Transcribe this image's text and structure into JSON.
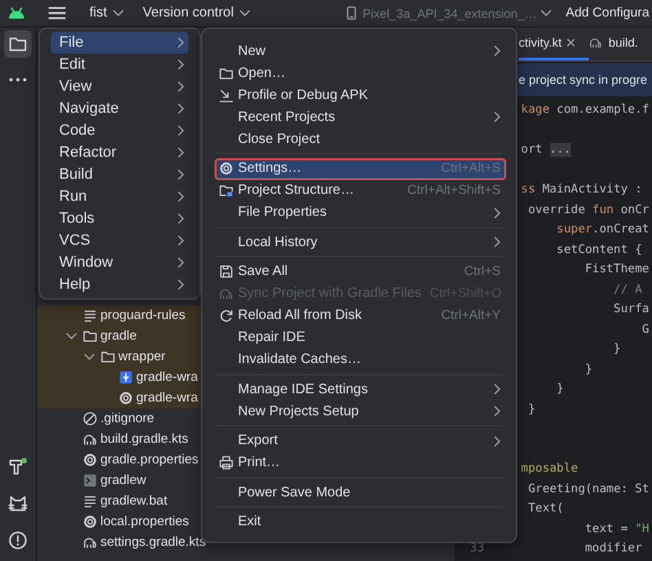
{
  "top_bar": {
    "project": "fist",
    "vcs": "Version control",
    "device": {
      "label": "Pixel_3a_API_34_extension_…",
      "disabled": true
    },
    "run_config": "Add Configura"
  },
  "tool_strip": {
    "top": [
      {
        "kind": "folder",
        "selected": true
      },
      {
        "kind": "more",
        "selected": false
      }
    ],
    "bottom": [
      {
        "kind": "hammer",
        "selected": false
      },
      {
        "kind": "cat",
        "selected": false
      },
      {
        "kind": "problems",
        "selected": false
      }
    ]
  },
  "project_tree": [
    {
      "name": "proguard-rules",
      "kind": "text",
      "shaded": true
    },
    {
      "name": "gradle",
      "kind": "folder",
      "expanded": true,
      "shaded": true,
      "children": [
        {
          "name": "wrapper",
          "kind": "folder",
          "expanded": true,
          "shaded": true,
          "children": [
            {
              "name": "gradle-wra",
              "kind": "archive",
              "shaded": true
            },
            {
              "name": "gradle-wra",
              "kind": "settings",
              "shaded": true
            }
          ]
        }
      ]
    },
    {
      "name": ".gitignore",
      "kind": "ignore",
      "shaded": false
    },
    {
      "name": "build.gradle.kts",
      "kind": "script",
      "shaded": false
    },
    {
      "name": "gradle.properties",
      "kind": "settings",
      "shaded": false
    },
    {
      "name": "gradlew",
      "kind": "terminal",
      "shaded": false
    },
    {
      "name": "gradlew.bat",
      "kind": "text",
      "shaded": false
    },
    {
      "name": "local.properties",
      "kind": "settings",
      "shaded": false
    },
    {
      "name": "settings.gradle.kts",
      "kind": "script",
      "shaded": false
    }
  ],
  "editor": {
    "tabs": [
      {
        "label": "ctivity.kt",
        "kind": "plain",
        "selected": true,
        "closable": true
      },
      {
        "label": "build.",
        "kind": "script",
        "selected": false,
        "closable": false
      }
    ],
    "notice": "e project sync in progre",
    "lines": [
      {
        "kind": "code",
        "tokens": [
          {
            "text": "kage",
            "kind": "keyword"
          },
          {
            "text": " com.example.f",
            "kind": "plain"
          }
        ]
      },
      {
        "kind": "blank"
      },
      {
        "kind": "code",
        "tokens": [
          {
            "text": "ort ",
            "kind": "plain"
          },
          {
            "text": "...",
            "kind": "fold"
          }
        ]
      },
      {
        "kind": "blank"
      },
      {
        "kind": "code",
        "tokens": [
          {
            "text": "ss",
            "kind": "keyword"
          },
          {
            "text": " MainActivity :",
            "kind": "plain"
          }
        ]
      },
      {
        "kind": "code",
        "tokens": [
          {
            "text": " override ",
            "kind": "plain"
          },
          {
            "text": "fun",
            "kind": "keyword"
          },
          {
            "text": " onCr",
            "kind": "plain"
          }
        ]
      },
      {
        "kind": "code",
        "tokens": [
          {
            "text": "     super",
            "kind": "keyword"
          },
          {
            "text": ".onCreat",
            "kind": "plain"
          }
        ]
      },
      {
        "kind": "code",
        "tokens": [
          {
            "text": "     setContent {",
            "kind": "plain"
          }
        ]
      },
      {
        "kind": "code",
        "tokens": [
          {
            "text": "         FistTheme",
            "kind": "plain"
          }
        ]
      },
      {
        "kind": "code",
        "tokens": [
          {
            "text": "             // A",
            "kind": "comment"
          }
        ]
      },
      {
        "kind": "code",
        "tokens": [
          {
            "text": "             Surfa",
            "kind": "plain"
          }
        ]
      },
      {
        "kind": "code",
        "tokens": [
          {
            "text": "                 G",
            "kind": "plain"
          }
        ]
      },
      {
        "kind": "code",
        "tokens": [
          {
            "text": "             }",
            "kind": "plain"
          }
        ]
      },
      {
        "kind": "code",
        "tokens": [
          {
            "text": "         }",
            "kind": "plain"
          }
        ]
      },
      {
        "kind": "code",
        "tokens": [
          {
            "text": "     }",
            "kind": "plain"
          }
        ]
      },
      {
        "kind": "code",
        "tokens": [
          {
            "text": " }",
            "kind": "plain"
          }
        ]
      },
      {
        "kind": "blank"
      },
      {
        "kind": "blank"
      },
      {
        "kind": "code",
        "tokens": [
          {
            "text": "mposable",
            "kind": "annotation"
          }
        ]
      },
      {
        "kind": "code",
        "tokens": [
          {
            "text": " Greeting",
            "kind": "plain"
          },
          {
            "text": "(name: St",
            "kind": "plain"
          }
        ]
      },
      {
        "kind": "code",
        "tokens": [
          {
            "text": " Text(",
            "kind": "plain"
          }
        ]
      },
      {
        "kind": "code",
        "tokens": [
          {
            "text": "         text = ",
            "kind": "param"
          },
          {
            "text": "\"H",
            "kind": "string"
          }
        ]
      },
      {
        "kind": "code",
        "number": "33",
        "tokens": [
          {
            "text": "         modifier",
            "kind": "param"
          }
        ]
      }
    ]
  },
  "main_menu": [
    {
      "label": "File",
      "selected": true,
      "submenu": true
    },
    {
      "label": "Edit",
      "selected": false,
      "submenu": true
    },
    {
      "label": "View",
      "selected": false,
      "submenu": true
    },
    {
      "label": "Navigate",
      "selected": false,
      "submenu": true
    },
    {
      "label": "Code",
      "selected": false,
      "submenu": true
    },
    {
      "label": "Refactor",
      "selected": false,
      "submenu": true
    },
    {
      "label": "Build",
      "selected": false,
      "submenu": true
    },
    {
      "label": "Run",
      "selected": false,
      "submenu": true
    },
    {
      "label": "Tools",
      "selected": false,
      "submenu": true
    },
    {
      "label": "VCS",
      "selected": false,
      "submenu": true
    },
    {
      "label": "Window",
      "selected": false,
      "submenu": true
    },
    {
      "label": "Help",
      "selected": false,
      "submenu": true
    }
  ],
  "file_menu": {
    "groups": [
      [
        {
          "label": "New",
          "kind": "plain",
          "selected": false,
          "disabled": false,
          "submenu": true
        },
        {
          "label": "Open…",
          "kind": "folder",
          "selected": false,
          "disabled": false
        },
        {
          "label": "Profile or Debug APK",
          "kind": "profile",
          "selected": false,
          "disabled": false
        },
        {
          "label": "Recent Projects",
          "kind": "plain",
          "selected": false,
          "disabled": false,
          "submenu": true
        },
        {
          "label": "Close Project",
          "kind": "plain",
          "selected": false,
          "disabled": false
        }
      ],
      [
        {
          "label": "Settings…",
          "kind": "gear",
          "shortcut": "Ctrl+Alt+S",
          "selected": true,
          "disabled": false
        },
        {
          "label": "Project Structure…",
          "kind": "structure",
          "shortcut": "Ctrl+Alt+Shift+S",
          "selected": false,
          "disabled": false
        },
        {
          "label": "File Properties",
          "kind": "plain",
          "selected": false,
          "disabled": false,
          "submenu": true
        }
      ],
      [
        {
          "label": "Local History",
          "kind": "plain",
          "selected": false,
          "disabled": false,
          "submenu": true
        }
      ],
      [
        {
          "label": "Save All",
          "kind": "save",
          "shortcut": "Ctrl+S",
          "selected": false,
          "disabled": false
        },
        {
          "label": "Sync Project with Gradle Files",
          "kind": "script",
          "shortcut": "Ctrl+Shift+O",
          "selected": false,
          "disabled": true
        },
        {
          "label": "Reload All from Disk",
          "kind": "reload",
          "shortcut": "Ctrl+Alt+Y",
          "selected": false,
          "disabled": false
        },
        {
          "label": "Repair IDE",
          "kind": "plain",
          "selected": false,
          "disabled": false
        },
        {
          "label": "Invalidate Caches…",
          "kind": "plain",
          "selected": false,
          "disabled": false
        }
      ],
      [
        {
          "label": "Manage IDE Settings",
          "kind": "plain",
          "selected": false,
          "disabled": false,
          "submenu": true
        },
        {
          "label": "New Projects Setup",
          "kind": "plain",
          "selected": false,
          "disabled": false,
          "submenu": true
        }
      ],
      [
        {
          "label": "Export",
          "kind": "plain",
          "selected": false,
          "disabled": false,
          "submenu": true
        },
        {
          "label": "Print…",
          "kind": "print",
          "selected": false,
          "disabled": false
        }
      ],
      [
        {
          "label": "Power Save Mode",
          "kind": "plain",
          "selected": false,
          "disabled": false
        }
      ],
      [
        {
          "label": "Exit",
          "kind": "plain",
          "selected": false,
          "disabled": false
        }
      ]
    ]
  }
}
